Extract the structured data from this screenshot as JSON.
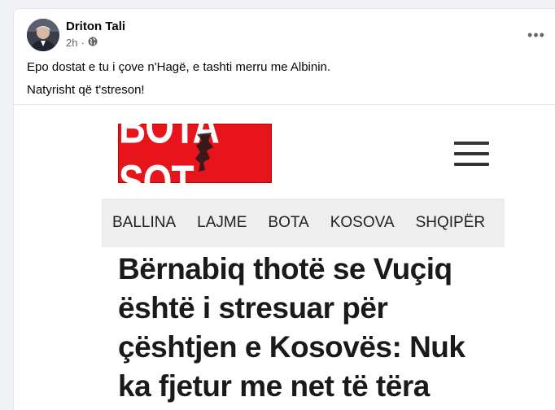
{
  "post": {
    "author": "Driton Tali",
    "time": "2h",
    "privacy_icon": "globe-icon",
    "more_icon": "more-options-icon",
    "text_line1": "Epo dostat e tu i çove n'Hagë, e tashti merru me Albinin.",
    "text_line2": "Natyrisht që t'streson!"
  },
  "shared": {
    "logo_text": "BOTA SOT",
    "menu_icon": "hamburger-menu-icon",
    "nav": [
      "BALLINA",
      "LAJME",
      "BOTA",
      "KOSOVA",
      "SHQIPËR"
    ],
    "headline": "Bërnabiq thotë se Vuçiq është i stresuar për çështjen e Kosovës: Nuk ka fjetur me net të tëra"
  },
  "colors": {
    "logo_red": "#e8141c",
    "nav_bg": "#eeeeee",
    "meta_gray": "#65676b"
  }
}
